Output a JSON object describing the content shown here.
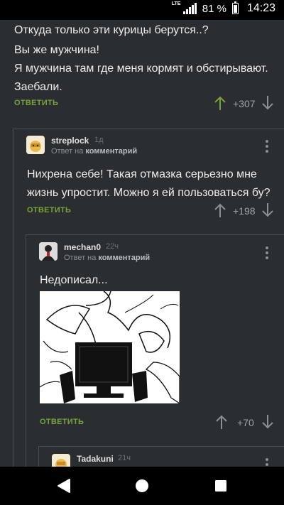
{
  "status": {
    "battery_percent": "81 %",
    "time": "14:23",
    "network": "LTE"
  },
  "comments": [
    {
      "lines": [
        "Откуда только эти курицы берутся..?",
        "Вы же мужчина!",
        "Я мужчина там где меня кормят и обстирывают.",
        "Заебали."
      ],
      "reply_label": "ОТВЕТИТЬ",
      "score": "+307"
    },
    {
      "username": "streplock",
      "time": "1д",
      "reply_prefix": "Ответ на",
      "reply_target": "комментарий",
      "lines": [
        "Нихрена себе! Такая отмазка серьезно мне",
        "жизнь упростит. Можно я ей пользоваться бу?"
      ],
      "reply_label": "ОТВЕТИТЬ",
      "score": "+198"
    },
    {
      "username": "mechan0",
      "time": "22ч",
      "reply_prefix": "Ответ на",
      "reply_target": "комментарий",
      "lines": [
        "Недописал..."
      ],
      "reply_label": "ОТВЕТИТЬ",
      "score": "+70"
    },
    {
      "username": "Tadakuni",
      "time": "21ч"
    }
  ]
}
